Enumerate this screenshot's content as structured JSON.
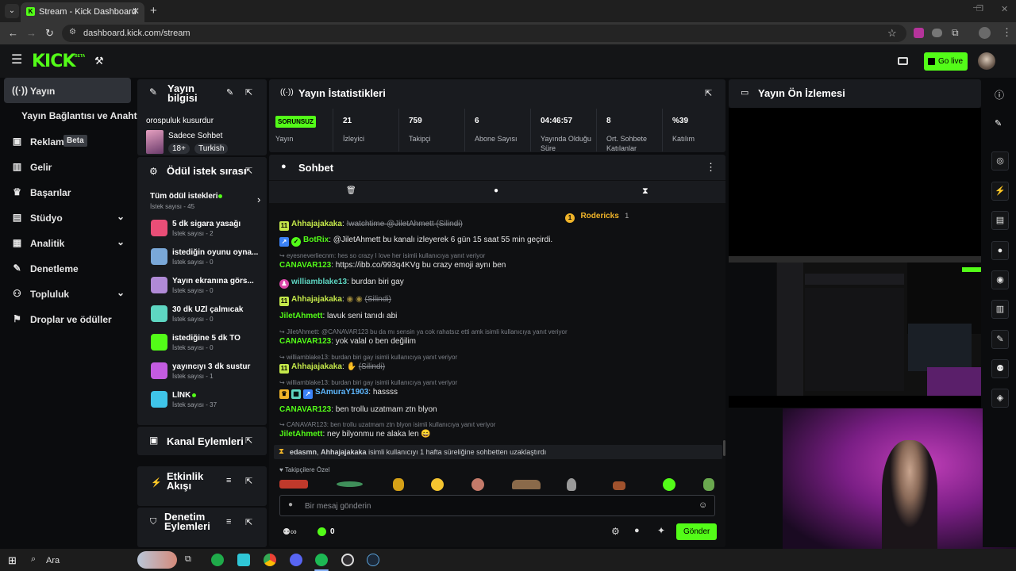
{
  "browser": {
    "tab_title": "Stream - Kick Dashboard",
    "url": "dashboard.kick.com/stream",
    "new_tab": "+"
  },
  "header": {
    "logo": "KICK",
    "logo_badge": "BETA",
    "go_live": "Go live"
  },
  "nav": {
    "items": [
      {
        "label": "Yayın",
        "icon": "stream-icon"
      },
      {
        "label": "Yayın Bağlantısı ve Anahtarı",
        "icon": ""
      },
      {
        "label": "Reklam",
        "icon": "ad-icon",
        "badge": "Beta"
      },
      {
        "label": "Gelir",
        "icon": "chart-icon"
      },
      {
        "label": "Başarılar",
        "icon": "trophy-icon"
      },
      {
        "label": "Stüdyo",
        "icon": "studio-icon"
      },
      {
        "label": "Analitik",
        "icon": "analytics-icon"
      },
      {
        "label": "Denetleme",
        "icon": "wrench-icon"
      },
      {
        "label": "Topluluk",
        "icon": "community-icon"
      },
      {
        "label": "Droplar ve ödüller",
        "icon": "gift-icon"
      }
    ]
  },
  "stream_info": {
    "title": "Yayın bilgisi",
    "stream_title": "orospuluk kusurdur",
    "category": "Sadece Sohbet",
    "tags": [
      "18+",
      "Turkish"
    ]
  },
  "rewards": {
    "title": "Ödül istek sırası",
    "all_label": "Tüm ödül istekleri",
    "all_count": "İstek sayısı - 45",
    "items": [
      {
        "title": "5 dk sigara yasağı",
        "count": "İstek sayısı - 2",
        "color": "#e94e77"
      },
      {
        "title": "istediğin oyunu oyna...",
        "count": "İstek sayısı - 0",
        "color": "#7aa8d8"
      },
      {
        "title": "Yayın ekranına görs...",
        "count": "İstek sayısı - 0",
        "color": "#b08ad6"
      },
      {
        "title": "30 dk UZİ çalmıcak",
        "count": "İstek sayısı - 0",
        "color": "#5ed6c2"
      },
      {
        "title": "istediğine 5 dk TO",
        "count": "İstek sayısı - 0",
        "color": "#53fc18"
      },
      {
        "title": "yayıncıyı 3 dk sustur",
        "count": "İstek sayısı - 1",
        "color": "#c35be0"
      },
      {
        "title": "LİNK",
        "count": "İstek sayısı - 37",
        "color": "#3fc4e8"
      }
    ]
  },
  "channel_actions": {
    "title": "Kanal Eylemleri"
  },
  "activity_feed": {
    "title": "Etkinlik Akışı"
  },
  "mod_actions": {
    "title": "Denetim Eylemleri"
  },
  "stats": {
    "title": "Yayın İstatistikleri",
    "items": [
      {
        "value": "SORUNSUZ",
        "label": "Yayın"
      },
      {
        "value": "21",
        "label": "İzleyici"
      },
      {
        "value": "759",
        "label": "Takipçi"
      },
      {
        "value": "6",
        "label": "Abone Sayısı"
      },
      {
        "value": "04:46:57",
        "label": "Yayında Olduğu Süre"
      },
      {
        "value": "8",
        "label": "Ort. Sohbete Katılanlar"
      },
      {
        "value": "%39",
        "label": "Katılım"
      }
    ]
  },
  "chat": {
    "title": "Sohbet",
    "pinned_user": "Rodericks",
    "pinned_count": "1",
    "messages": [
      {
        "user": "Ahhajajakaka",
        "text": "!watchtime @JiletAhmett (Silindi)",
        "color": "#c4e84a"
      },
      {
        "user": "BotRix",
        "text": "@JiletAhmett bu kanalı izleyerek 6 gün 15 saat 55 min geçirdi.",
        "color": "#53fc18"
      },
      {
        "user": "CANAVAR123",
        "text": "https://ibb.co/993q4KVg bu crazy emoji aynı ben",
        "color": "#53fc18",
        "reply": "eyesneverliecnm: hes so crazy I love her isimli kullanıcıya yanıt veriyor"
      },
      {
        "user": "williamblake13",
        "text": "burdan biri gay",
        "color": "#5ed6c2"
      },
      {
        "user": "Ahhajajakaka",
        "text": "(Silindi)",
        "color": "#c4e84a"
      },
      {
        "user": "JiletAhmett",
        "text": "lavuk seni tanıdı abi",
        "color": "#53fc18"
      },
      {
        "user": "CANAVAR123",
        "text": "yok valal o ben değilim",
        "color": "#53fc18",
        "reply": "JiletAhmett: @CANAVAR123 bu da mı sensin ya cok rahatsız etti amk isimli kullanıcıya yanıt veriyor"
      },
      {
        "user": "Ahhajajakaka",
        "text": "(Silindi)",
        "color": "#c4e84a",
        "reply": "williamblake13: burdan biri gay isimli kullanıcıya yanıt veriyor"
      },
      {
        "user": "SAmuraY1903",
        "text": "hassss",
        "color": "#5eb8ff",
        "reply": "williamblake13: burdan biri gay isimli kullanıcıya yanıt veriyor"
      },
      {
        "user": "CANAVAR123",
        "text": "ben trollu uzatmam ztn blyon",
        "color": "#53fc18"
      },
      {
        "user": "JiletAhmett",
        "text": "ney bilyonmu ne alaka len 😄",
        "color": "#53fc18",
        "reply": "CANAVAR123: ben trollu uzatmam ztn blyon isimli kullanıcıya yanıt veriyor"
      }
    ],
    "mod_notice_user1": "edasmn",
    "mod_notice_user2": "Ahhajajakaka",
    "mod_notice_text": "isimli kullanıcıyı 1 hafta süreliğine sohbetten uzaklaştırdı",
    "emote_section": "Takipçilere Özel",
    "input_placeholder": "Bir mesaj gönderin",
    "points": "0",
    "send": "Gönder"
  },
  "preview": {
    "title": "Yayın Ön İzlemesi"
  },
  "taskbar": {
    "search": "Ara"
  },
  "colors": {
    "accent": "#53fc18",
    "panel": "#191b1f",
    "background": "#0b0c0e"
  }
}
